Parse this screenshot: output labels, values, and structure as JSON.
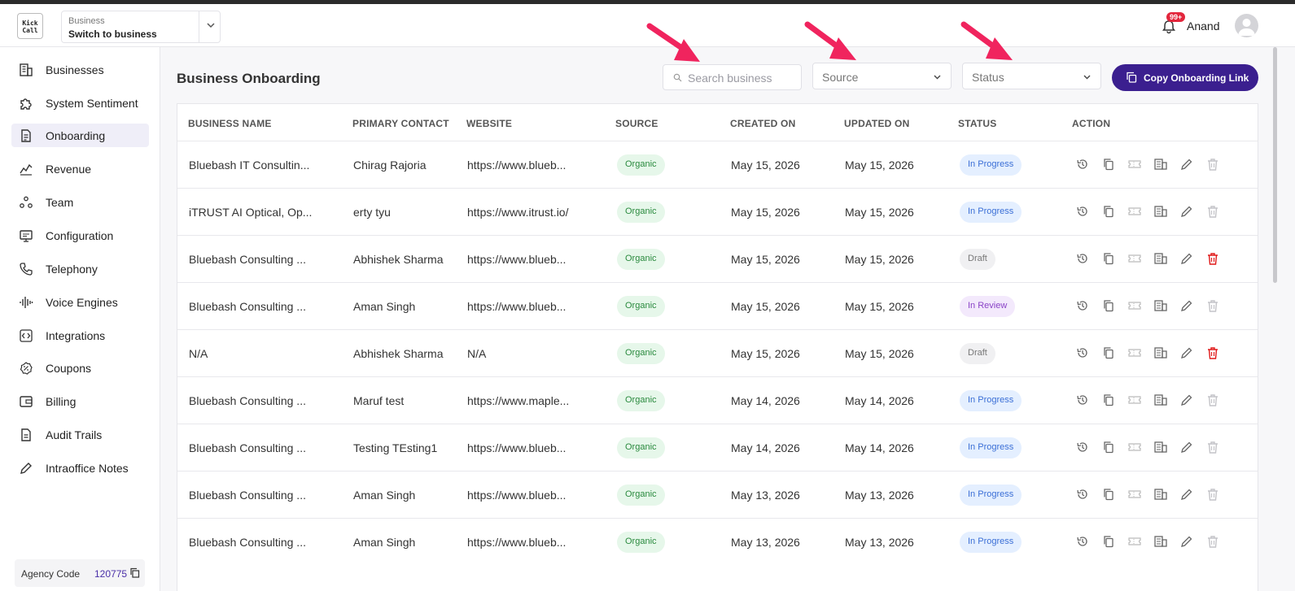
{
  "header": {
    "logo_text": "Kick Call",
    "switcher_label": "Business",
    "switcher_value": "Switch to business",
    "notification_badge": "99+",
    "user_name": "Anand"
  },
  "sidebar": {
    "items": [
      {
        "label": "Businesses",
        "icon": "building-icon"
      },
      {
        "label": "System Sentiment",
        "icon": "puzzle-icon"
      },
      {
        "label": "Onboarding",
        "icon": "document-icon",
        "active": true
      },
      {
        "label": "Revenue",
        "icon": "chart-icon"
      },
      {
        "label": "Team",
        "icon": "team-icon"
      },
      {
        "label": "Configuration",
        "icon": "monitor-icon"
      },
      {
        "label": "Telephony",
        "icon": "phone-icon"
      },
      {
        "label": "Voice Engines",
        "icon": "waveform-icon"
      },
      {
        "label": "Integrations",
        "icon": "code-icon"
      },
      {
        "label": "Coupons",
        "icon": "coupon-icon"
      },
      {
        "label": "Billing",
        "icon": "wallet-icon"
      },
      {
        "label": "Audit Trails",
        "icon": "file-icon"
      },
      {
        "label": "Intraoffice Notes",
        "icon": "pencil-icon"
      }
    ],
    "agency_label": "Agency Code",
    "agency_code": "120775"
  },
  "main": {
    "title": "Business Onboarding",
    "search_placeholder": "Search business",
    "source_placeholder": "Source",
    "status_placeholder": "Status",
    "copy_button": "Copy Onboarding Link"
  },
  "table": {
    "columns": [
      "BUSINESS NAME",
      "PRIMARY CONTACT",
      "WEBSITE",
      "SOURCE",
      "CREATED ON",
      "UPDATED ON",
      "STATUS",
      "ACTION"
    ],
    "rows": [
      {
        "name": "Bluebash IT Consultin...",
        "contact": "Chirag Rajoria",
        "website": "https://www.blueb...",
        "source": "Organic",
        "created": "May 15, 2026",
        "updated": "May 15, 2026",
        "status": "In Progress",
        "delete_active": false
      },
      {
        "name": "iTRUST AI Optical, Op...",
        "contact": "erty tyu",
        "website": "https://www.itrust.io/",
        "source": "Organic",
        "created": "May 15, 2026",
        "updated": "May 15, 2026",
        "status": "In Progress",
        "delete_active": false
      },
      {
        "name": "Bluebash Consulting ...",
        "contact": "Abhishek Sharma",
        "website": "https://www.blueb...",
        "source": "Organic",
        "created": "May 15, 2026",
        "updated": "May 15, 2026",
        "status": "Draft",
        "delete_active": true
      },
      {
        "name": "Bluebash Consulting ...",
        "contact": "Aman Singh",
        "website": "https://www.blueb...",
        "source": "Organic",
        "created": "May 15, 2026",
        "updated": "May 15, 2026",
        "status": "In Review",
        "delete_active": false
      },
      {
        "name": "N/A",
        "contact": "Abhishek Sharma",
        "website": "N/A",
        "source": "Organic",
        "created": "May 15, 2026",
        "updated": "May 15, 2026",
        "status": "Draft",
        "delete_active": true
      },
      {
        "name": "Bluebash Consulting ...",
        "contact": "Maruf test",
        "website": "https://www.maple...",
        "source": "Organic",
        "created": "May 14, 2026",
        "updated": "May 14, 2026",
        "status": "In Progress",
        "delete_active": false
      },
      {
        "name": "Bluebash Consulting ...",
        "contact": "Testing TEsting1",
        "website": "https://www.blueb...",
        "source": "Organic",
        "created": "May 14, 2026",
        "updated": "May 14, 2026",
        "status": "In Progress",
        "delete_active": false
      },
      {
        "name": "Bluebash Consulting ...",
        "contact": "Aman Singh",
        "website": "https://www.blueb...",
        "source": "Organic",
        "created": "May 13, 2026",
        "updated": "May 13, 2026",
        "status": "In Progress",
        "delete_active": false
      },
      {
        "name": "Bluebash Consulting ...",
        "contact": "Aman Singh",
        "website": "https://www.blueb...",
        "source": "Organic",
        "created": "May 13, 2026",
        "updated": "May 13, 2026",
        "status": "In Progress",
        "delete_active": false
      }
    ]
  },
  "colors": {
    "accent": "#3b1f8f",
    "arrow": "#f0245e",
    "delete_active": "#e01a1a"
  }
}
